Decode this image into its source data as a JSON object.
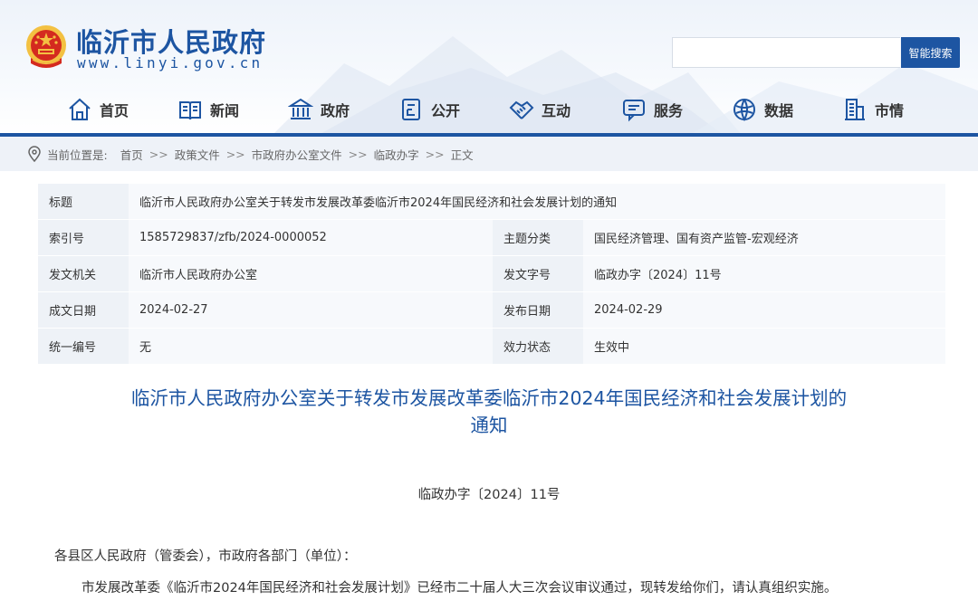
{
  "site": {
    "name": "临沂市人民政府",
    "url": "www.linyi.gov.cn"
  },
  "search": {
    "placeholder": "",
    "button_label": "智能搜索"
  },
  "nav": {
    "items": [
      {
        "label": "首页",
        "icon": "home-icon"
      },
      {
        "label": "新闻",
        "icon": "news-icon"
      },
      {
        "label": "政府",
        "icon": "government-icon"
      },
      {
        "label": "公开",
        "icon": "document-icon"
      },
      {
        "label": "互动",
        "icon": "handshake-icon"
      },
      {
        "label": "服务",
        "icon": "chat-icon"
      },
      {
        "label": "数据",
        "icon": "globe-icon"
      },
      {
        "label": "市情",
        "icon": "building-icon"
      }
    ]
  },
  "breadcrumb": {
    "current_label": "当前位置是:",
    "separator": ">>",
    "items": [
      "首页",
      "政策文件",
      "市政府办公室文件",
      "临政办字",
      "正文"
    ]
  },
  "info": {
    "title_label": "标题",
    "title_value": "临沂市人民政府办公室关于转发市发展改革委临沂市2024年国民经济和社会发展计划的通知",
    "index_label": "索引号",
    "index_value": "1585729837/zfb/2024-0000052",
    "topic_label": "主题分类",
    "topic_value": "国民经济管理、国有资产监管-宏观经济",
    "issuer_label": "发文机关",
    "issuer_value": "临沂市人民政府办公室",
    "docno_label": "发文字号",
    "docno_value": "临政办字〔2024〕11号",
    "created_label": "成文日期",
    "created_value": "2024-02-27",
    "published_label": "发布日期",
    "published_value": "2024-02-29",
    "uniform_label": "统一编号",
    "uniform_value": "无",
    "status_label": "效力状态",
    "status_value": "生效中"
  },
  "document": {
    "title_line1": "临沂市人民政府办公室关于转发市发展改革委临沂市2024年国民经济和社会发展计划的",
    "title_line2": "通知",
    "number": "临政办字〔2024〕11号",
    "salutation": "各县区人民政府（管委会），市政府各部门（单位）：",
    "paragraph1": "市发展改革委《临沂市2024年国民经济和社会发展计划》已经市二十届人大三次会议审议通过，现转发给你们，请认真组织实施。"
  },
  "colors": {
    "brand_blue": "#1d55a2",
    "emblem_red": "#d42a1f",
    "emblem_gold": "#f3c142"
  }
}
